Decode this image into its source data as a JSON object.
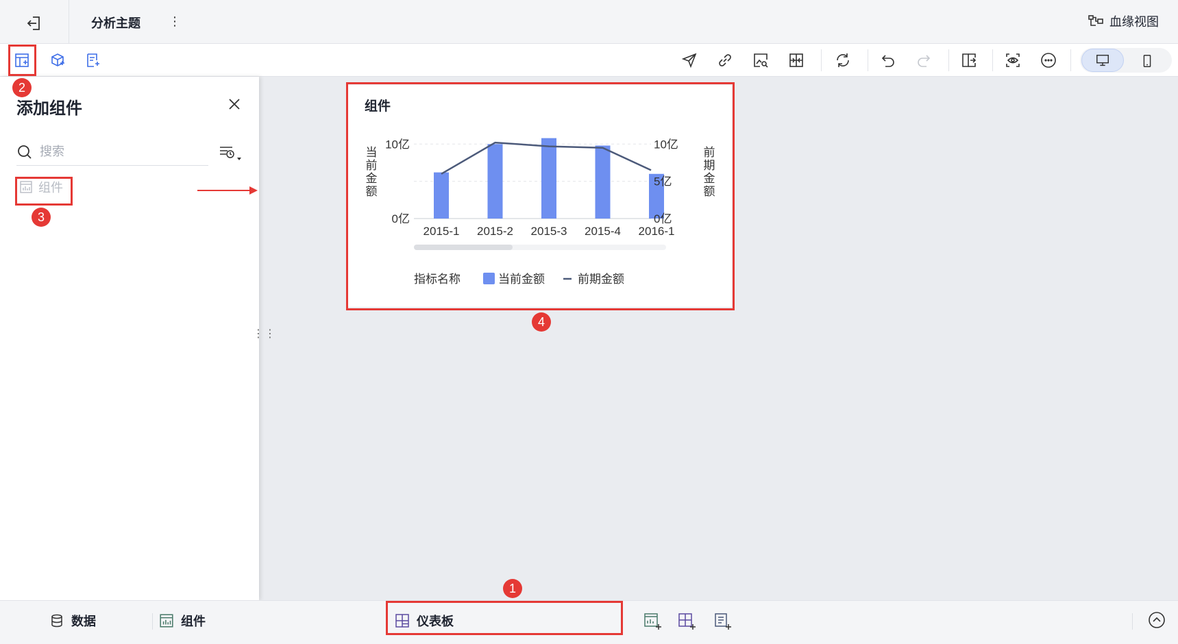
{
  "header": {
    "title": "分析主题",
    "lineage_label": "血缘视图"
  },
  "panel": {
    "title": "添加组件",
    "search_placeholder": "搜索",
    "item_label": "组件"
  },
  "widget": {
    "title": "组件"
  },
  "chart_data": {
    "type": "bar",
    "categories": [
      "2015-1",
      "2015-2",
      "2015-3",
      "2015-4",
      "2016-1"
    ],
    "series": [
      {
        "name": "当前金额",
        "type": "bar",
        "axis": "left",
        "values": [
          6.2,
          10,
          10.8,
          9.8,
          6
        ],
        "color": "#6e8ff0"
      },
      {
        "name": "前期金额",
        "type": "line",
        "axis": "right",
        "values": [
          6,
          10.2,
          9.7,
          9.5,
          6.5
        ],
        "color": "#4c5a7a"
      }
    ],
    "ylabel": "当前金额",
    "ylabel_right": "前期金额",
    "ylim": [
      0,
      11.5
    ],
    "ylim_right": [
      0,
      11.5
    ],
    "yticks_left": [
      "0亿",
      "10亿"
    ],
    "yticks_right": [
      "0亿",
      "5亿",
      "10亿"
    ],
    "legend_title": "指标名称",
    "legend_position": "bottom",
    "grid": true
  },
  "bottom": {
    "data_tab": "数据",
    "component_tab": "组件",
    "dashboard_tab": "仪表板"
  },
  "annotations": [
    "1",
    "2",
    "3",
    "4"
  ]
}
